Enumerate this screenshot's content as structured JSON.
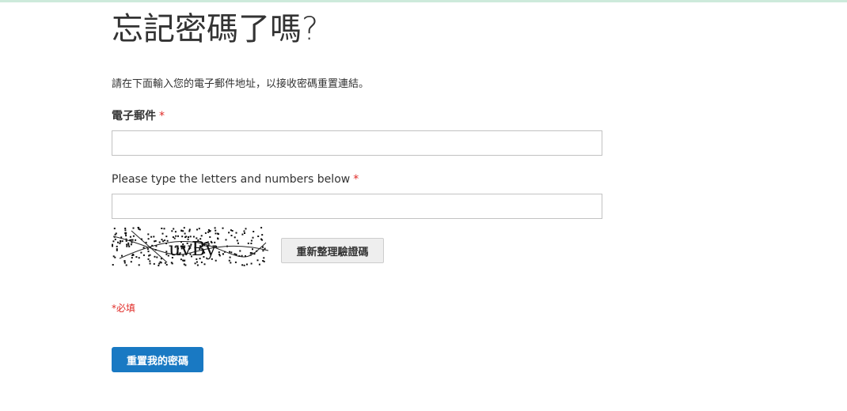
{
  "colors": {
    "top_bar": "#cdeadb",
    "required": "#e02b27",
    "primary_button": "#1979c3"
  },
  "page": {
    "title": "忘記密碼了嗎?",
    "intro": "請在下面輸入您的電子郵件地址，以接收密碼重置連結。"
  },
  "form": {
    "email": {
      "label": "電子郵件",
      "required_mark": "*",
      "value": "",
      "placeholder": ""
    },
    "captcha": {
      "label": "Please type the letters and numbers below",
      "required_mark": "*",
      "value": "",
      "placeholder": "",
      "image_text": "uvBy",
      "reload_label": "重新整理驗證碼"
    },
    "required_note": "*必填",
    "submit_label": "重置我的密碼"
  }
}
